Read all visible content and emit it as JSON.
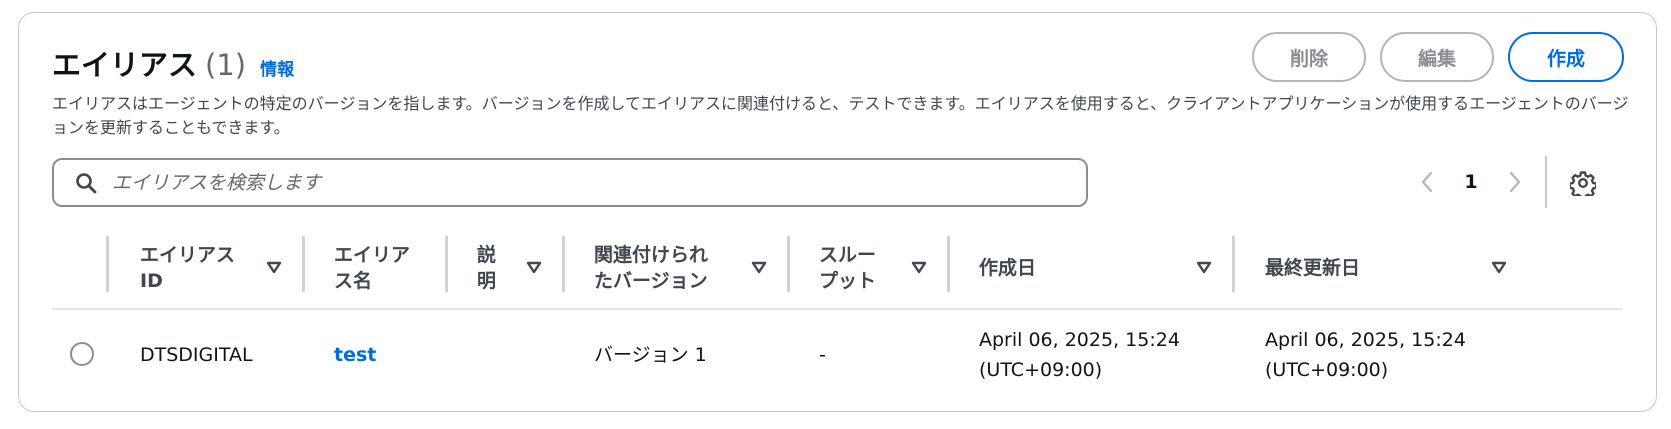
{
  "header": {
    "title": "エイリアス",
    "count": "(1)",
    "info_link": "情報",
    "delete_label": "削除",
    "edit_label": "編集",
    "create_label": "作成"
  },
  "description": "エイリアスはエージェントの特定のバージョンを指します。バージョンを作成してエイリアスに関連付けると、テストできます。エイリアスを使用すると、クライアントアプリケーションが使用するエージェントのバージョンを更新することもできます。",
  "search": {
    "placeholder": "エイリアスを検索します",
    "value": ""
  },
  "pagination": {
    "current_page": "1"
  },
  "table": {
    "columns": [
      {
        "line1": "エイリアス",
        "line2": "ID"
      },
      {
        "line1": "エイリア",
        "line2": "ス名"
      },
      {
        "line1": "説",
        "line2": "明"
      },
      {
        "line1": "関連付けられ",
        "line2": "たバージョン"
      },
      {
        "line1": "スルー",
        "line2": "プット"
      },
      {
        "line1": "作成日",
        "line2": ""
      },
      {
        "line1": "最終更新日",
        "line2": ""
      }
    ],
    "rows": [
      {
        "alias_id": "DTSDIGITAL",
        "alias_name": "test",
        "description": "",
        "version": "バージョン 1",
        "throughput": "-",
        "created_line1": "April 06, 2025, 15:24",
        "created_line2": "(UTC+09:00)",
        "updated_line1": "April 06, 2025, 15:24",
        "updated_line2": "(UTC+09:00)"
      }
    ]
  },
  "colors": {
    "accent": "#006ce0",
    "text": "#0f141a",
    "muted": "#656871",
    "border": "#c6c6cd",
    "disabled": "#8c8c94"
  },
  "icons": {
    "search": "search-icon",
    "prev": "chevron-left-icon",
    "next": "chevron-right-icon",
    "settings": "gear-icon",
    "sort": "sort-caret-down-icon"
  }
}
